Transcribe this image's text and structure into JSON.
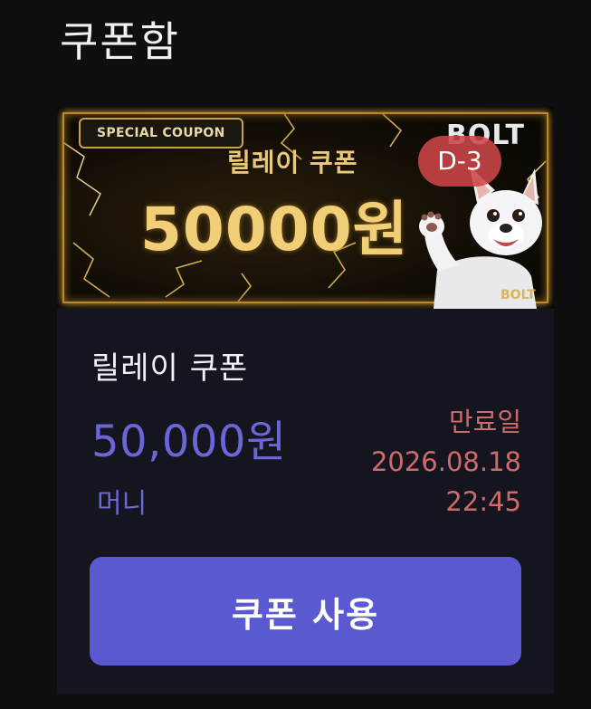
{
  "header": {
    "title": "쿠폰함"
  },
  "coupon": {
    "banner": {
      "special_tag": "SPECIAL COUPON",
      "subtitle": "릴레이 쿠폰",
      "amount": "50000원",
      "brand": "BOLT",
      "brand_small": "BOLT",
      "dday": "D-3"
    },
    "name": "릴레이 쿠폰",
    "amount": "50,000원",
    "type": "머니",
    "expiry_label": "만료일",
    "expiry_date": "2026.08.18",
    "expiry_time": "22:45",
    "use_button_label": "쿠폰 사용"
  },
  "colors": {
    "background": "#0e0e10",
    "card": "#15151f",
    "accent": "#5b59cf",
    "amount": "#6b66d6",
    "expiry": "#cf6a6a",
    "dday_badge": "#cd4648",
    "gold": "#f1cf78"
  }
}
